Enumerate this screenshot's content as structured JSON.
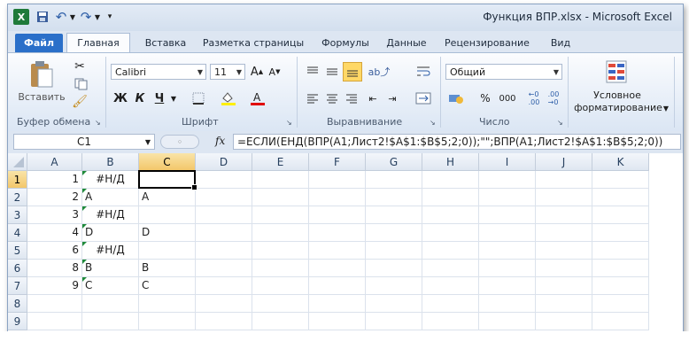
{
  "window": {
    "title": "Функция ВПР.xlsx - Microsoft Excel",
    "app_icon": "X"
  },
  "quick_access": [
    {
      "icon": "save-icon",
      "glyph": "💾"
    },
    {
      "icon": "undo-icon",
      "glyph": "↶"
    },
    {
      "icon": "undo-dropdown-icon",
      "glyph": "▾"
    },
    {
      "icon": "redo-icon",
      "glyph": "↷"
    },
    {
      "icon": "redo-dropdown-icon",
      "glyph": "▾"
    },
    {
      "icon": "customize-icon",
      "glyph": "⋮"
    }
  ],
  "tabs": [
    "Файл",
    "Главная",
    "Вставка",
    "Разметка страницы",
    "Формулы",
    "Данные",
    "Рецензирование",
    "Вид"
  ],
  "ribbon": {
    "clipboard": {
      "label": "Буфер обмена",
      "paste": "Вставить"
    },
    "font": {
      "label": "Шрифт",
      "name": "Calibri",
      "size": "11",
      "bold": "Ж",
      "italic": "К",
      "underline": "Ч"
    },
    "alignment": {
      "label": "Выравнивание"
    },
    "number": {
      "label": "Число",
      "format": "Общий",
      "percent": "%",
      "thousands": "000"
    },
    "styles": {
      "conditional_line1": "Условное",
      "conditional_line2": "форматирование"
    }
  },
  "formula_bar": {
    "name_box": "C1",
    "fx": "fx",
    "formula": "=ЕСЛИ(ЕНД(ВПР(A1;Лист2!$A$1:$B$5;2;0));\"\";ВПР(A1;Лист2!$A$1:$B$5;2;0))"
  },
  "sheet": {
    "columns": [
      "A",
      "B",
      "C",
      "D",
      "E",
      "F",
      "G",
      "H",
      "I",
      "J",
      "K"
    ],
    "rows": [
      "1",
      "2",
      "3",
      "4",
      "5",
      "6",
      "7",
      "8",
      "9"
    ],
    "selected_cell": "C1",
    "cells": [
      {
        "row": 1,
        "a": "1",
        "b": "#Н/Д",
        "c": ""
      },
      {
        "row": 2,
        "a": "2",
        "b": "A",
        "c": "A"
      },
      {
        "row": 3,
        "a": "3",
        "b": "#Н/Д",
        "c": ""
      },
      {
        "row": 4,
        "a": "4",
        "b": "D",
        "c": "D"
      },
      {
        "row": 5,
        "a": "6",
        "b": "#Н/Д",
        "c": ""
      },
      {
        "row": 6,
        "a": "8",
        "b": "B",
        "c": "B"
      },
      {
        "row": 7,
        "a": "9",
        "b": "C",
        "c": "C"
      }
    ]
  }
}
